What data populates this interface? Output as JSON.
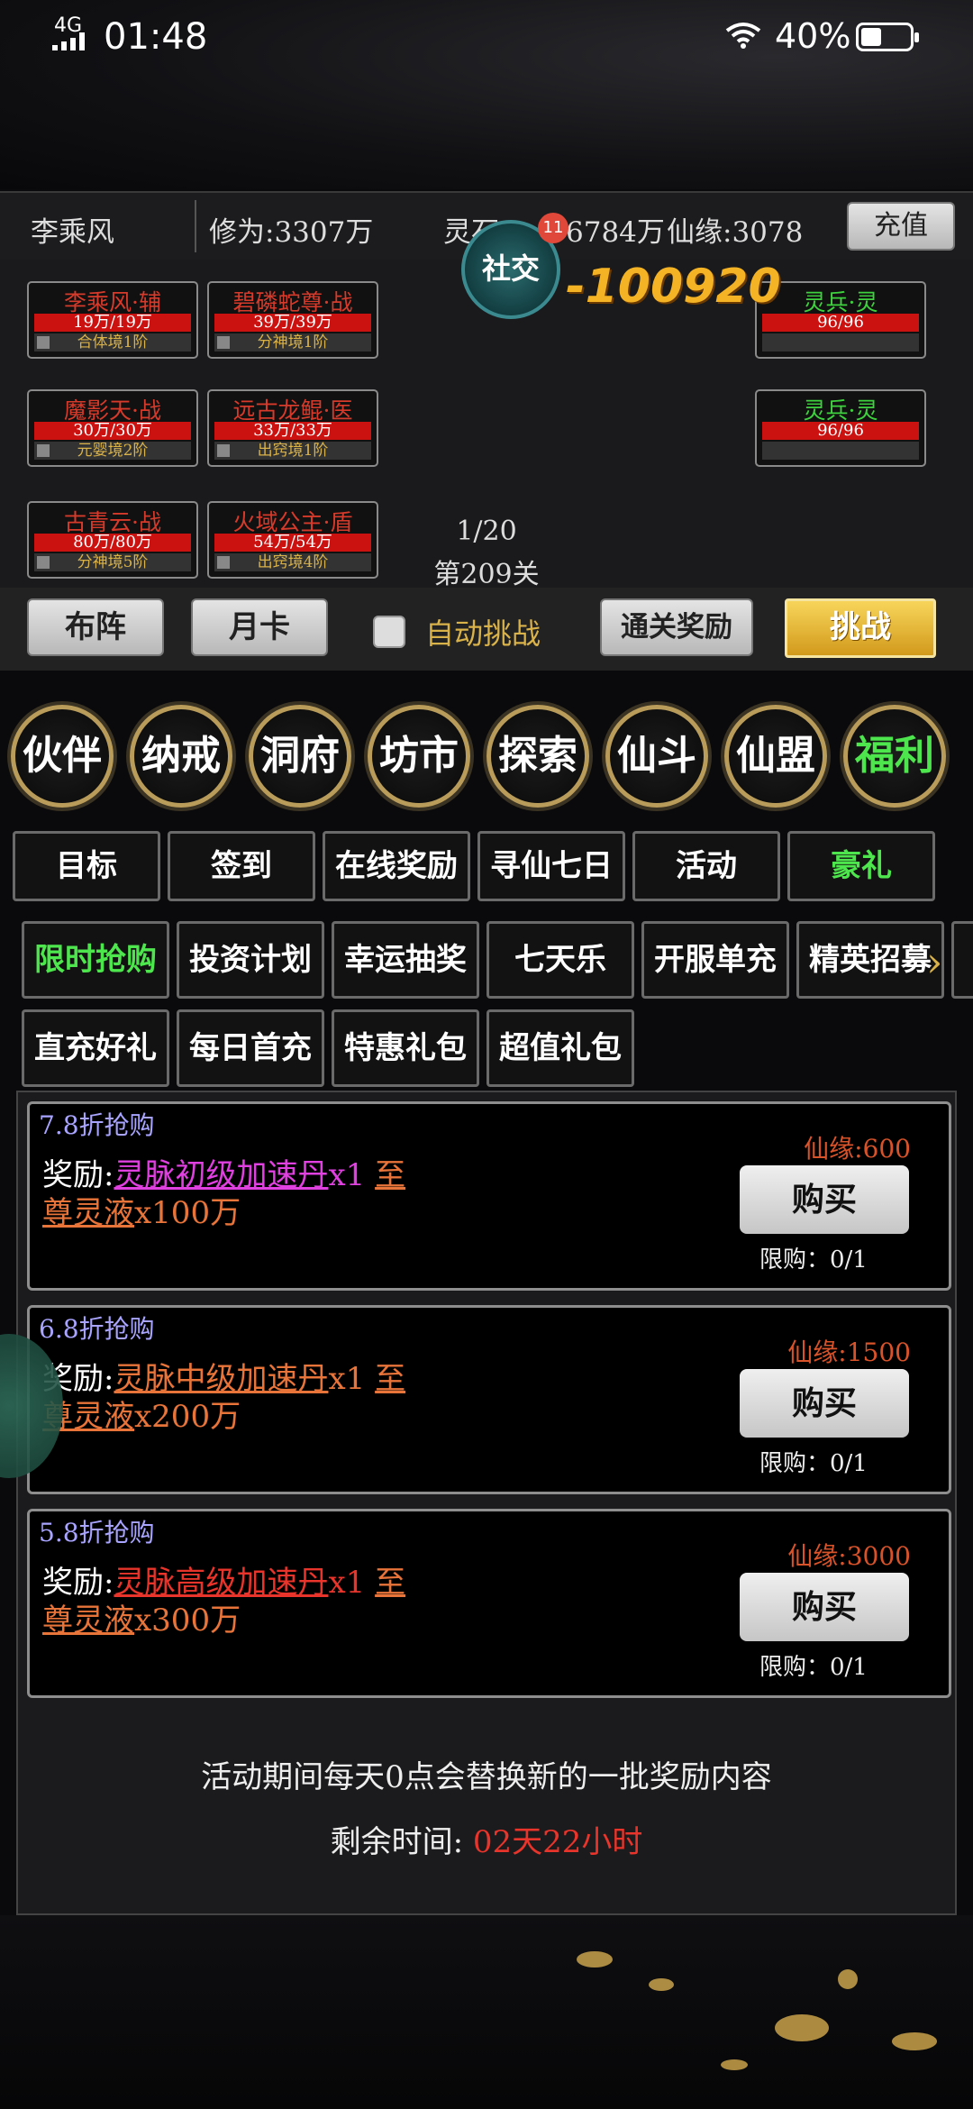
{
  "status_bar": {
    "network": "4G",
    "time": "01:48",
    "battery": "40%"
  },
  "info_bar": {
    "player_name": "李乘风",
    "cultivation": "修为:3307万",
    "spirit_stones_prefix": "灵石:1",
    "spirit_stones_suffix": "6784万",
    "xianyuan": "仙缘:3078",
    "recharge": "充值"
  },
  "battle": {
    "social_label": "社交",
    "social_badge": "11",
    "damage": "-100920",
    "progress": "1/20",
    "stage": "第209关",
    "allies": [
      {
        "name": "李乘风·辅",
        "hp": "19万/19万",
        "rank": "合体境1阶"
      },
      {
        "name": "碧磷蛇尊·战",
        "hp": "39万/39万",
        "rank": "分神境1阶"
      },
      {
        "name": "魔影天·战",
        "hp": "30万/30万",
        "rank": "元婴境2阶"
      },
      {
        "name": "远古龙鲲·医",
        "hp": "33万/33万",
        "rank": "出窍境1阶"
      },
      {
        "name": "古青云·战",
        "hp": "80万/80万",
        "rank": "分神境5阶"
      },
      {
        "name": "火域公主·盾",
        "hp": "54万/54万",
        "rank": "出窍境4阶"
      }
    ],
    "enemies": [
      {
        "name": "灵兵·灵",
        "hp": "96/96"
      },
      {
        "name": "灵兵·灵",
        "hp": "96/96"
      }
    ],
    "formation_btn": "布阵",
    "monthly_btn": "月卡",
    "auto_label": "自动挑战",
    "clear_reward_btn": "通关奖励",
    "challenge_btn": "挑战"
  },
  "main_menu": [
    "伙伴",
    "纳戒",
    "洞府",
    "坊市",
    "探索",
    "仙斗",
    "仙盟",
    "福利"
  ],
  "welfare_tabs": [
    "目标",
    "签到",
    "在线奖励",
    "寻仙七日",
    "活动",
    "豪礼"
  ],
  "gift_tabs_row1": [
    "限时抢购",
    "投资计划",
    "幸运抽奖",
    "七天乐",
    "开服单充",
    "精英招募"
  ],
  "gift_tabs_row2": [
    "直充好礼",
    "每日首充",
    "特惠礼包",
    "超值礼包"
  ],
  "deals": [
    {
      "discount": "7.8折抢购",
      "reward_label": "奖励:",
      "item1": "灵脉初级加速丹",
      "qty1": "x1",
      "item2_a": "至",
      "item2_b": "尊灵液",
      "qty2": "x100万",
      "price": "仙缘:600",
      "buy": "购买",
      "limit": "限购：0/1",
      "item1_color": "#e040e0"
    },
    {
      "discount": "6.8折抢购",
      "reward_label": "奖励:",
      "item1": "灵脉中级加速丹",
      "qty1": "x1",
      "item2_a": "至",
      "item2_b": "尊灵液",
      "qty2": "x200万",
      "price": "仙缘:1500",
      "buy": "购买",
      "limit": "限购：0/1",
      "item1_color": "#e8743a"
    },
    {
      "discount": "5.8折抢购",
      "reward_label": "奖励:",
      "item1": "灵脉高级加速丹",
      "qty1": "x1",
      "item2_a": "至",
      "item2_b": "尊灵液",
      "qty2": "x300万",
      "price": "仙缘:3000",
      "buy": "购买",
      "limit": "限购：0/1",
      "item1_color": "#e8342a"
    }
  ],
  "footer": {
    "notice": "活动期间每天0点会替换新的一批奖励内容",
    "remaining_label": "剩余时间:",
    "remaining_value": "02天22小时"
  }
}
